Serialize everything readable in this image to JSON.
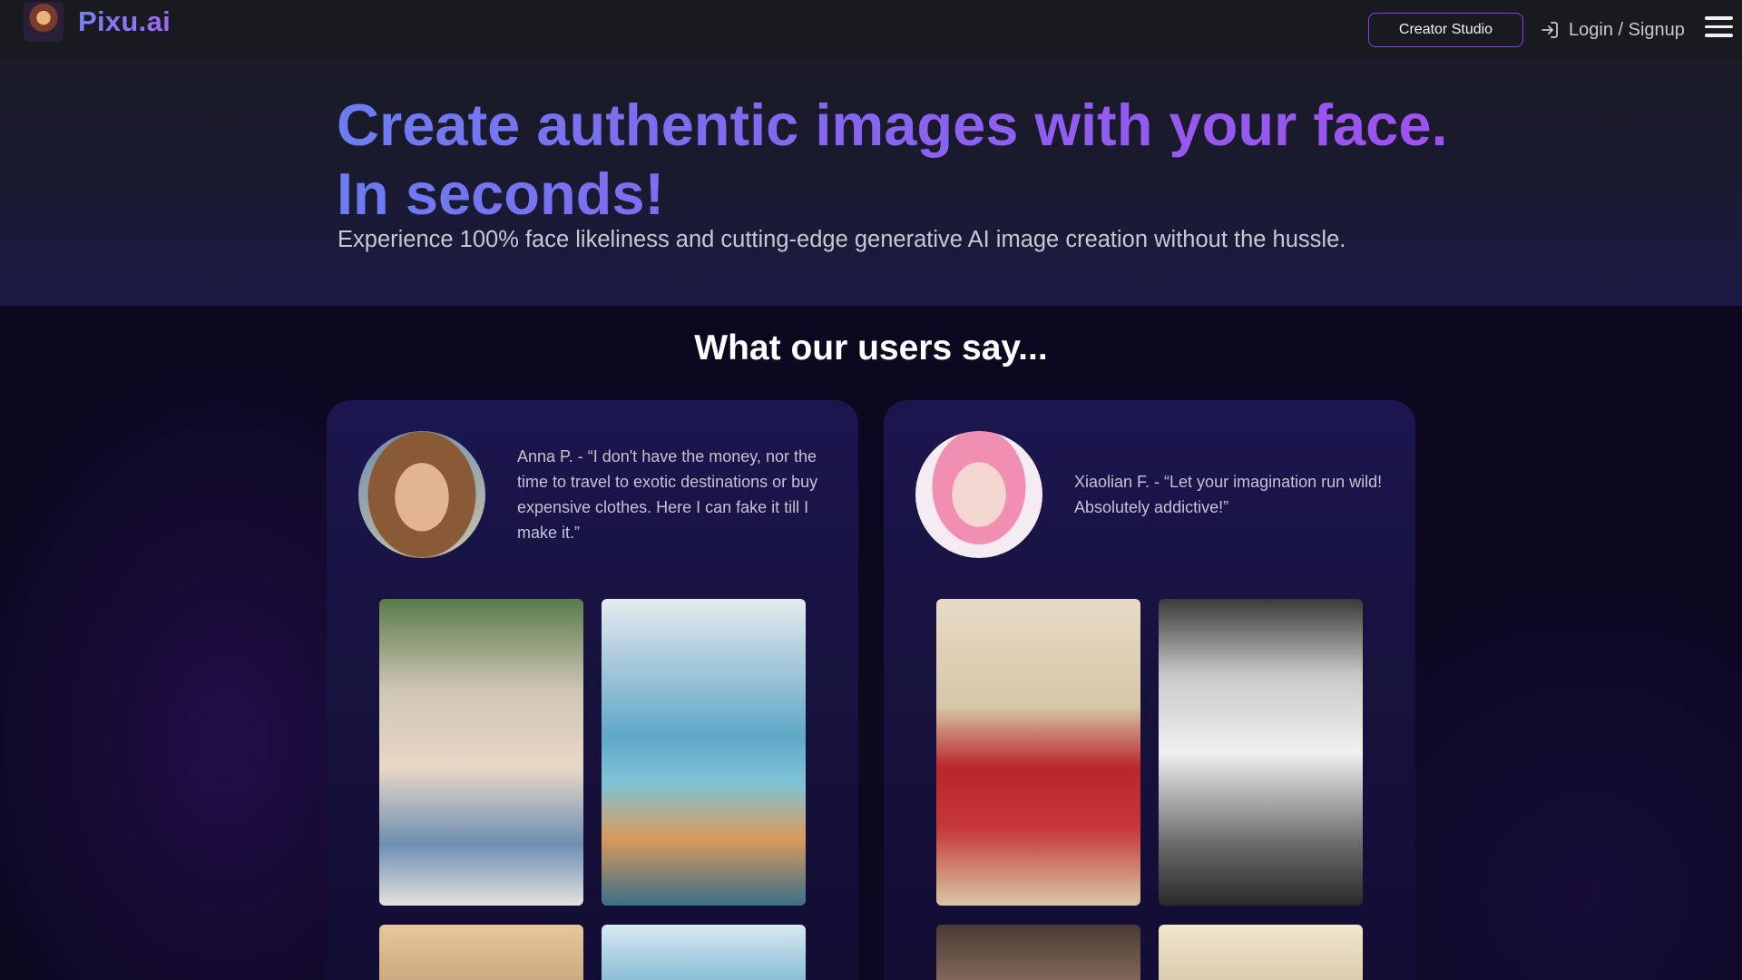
{
  "header": {
    "brand": "Pixu.ai",
    "creator_studio_label": "Creator Studio",
    "login_label": "Login / Signup",
    "icons": {
      "logo": "dragon-logo",
      "login": "login-arrow-icon",
      "menu": "hamburger-menu-icon"
    }
  },
  "hero": {
    "title_line1": "Create authentic images with your face.",
    "title_line2": "In seconds!",
    "subtitle": "Experience 100% face likeliness and cutting-edge generative AI image creation without the hussle."
  },
  "testimonials": {
    "heading": "What our users say...",
    "cards": [
      {
        "quote": "Anna P. - “I don't have the money, nor the time to travel to exotic destinations or buy expensive clothes. Here I can fake it till I make it.”",
        "avatar": "anna-avatar"
      },
      {
        "quote": "Xiaolian F. - “Let your imagination run wild! Absolutely addictive!”",
        "avatar": "xiaolian-avatar"
      }
    ]
  },
  "colors": {
    "accent_purple": "#8a3cf0",
    "title_gradient_start": "#6c7cf0",
    "title_gradient_end": "#a24ef0",
    "header_bg": "#191a1f",
    "card_bg": "#1c1650"
  }
}
